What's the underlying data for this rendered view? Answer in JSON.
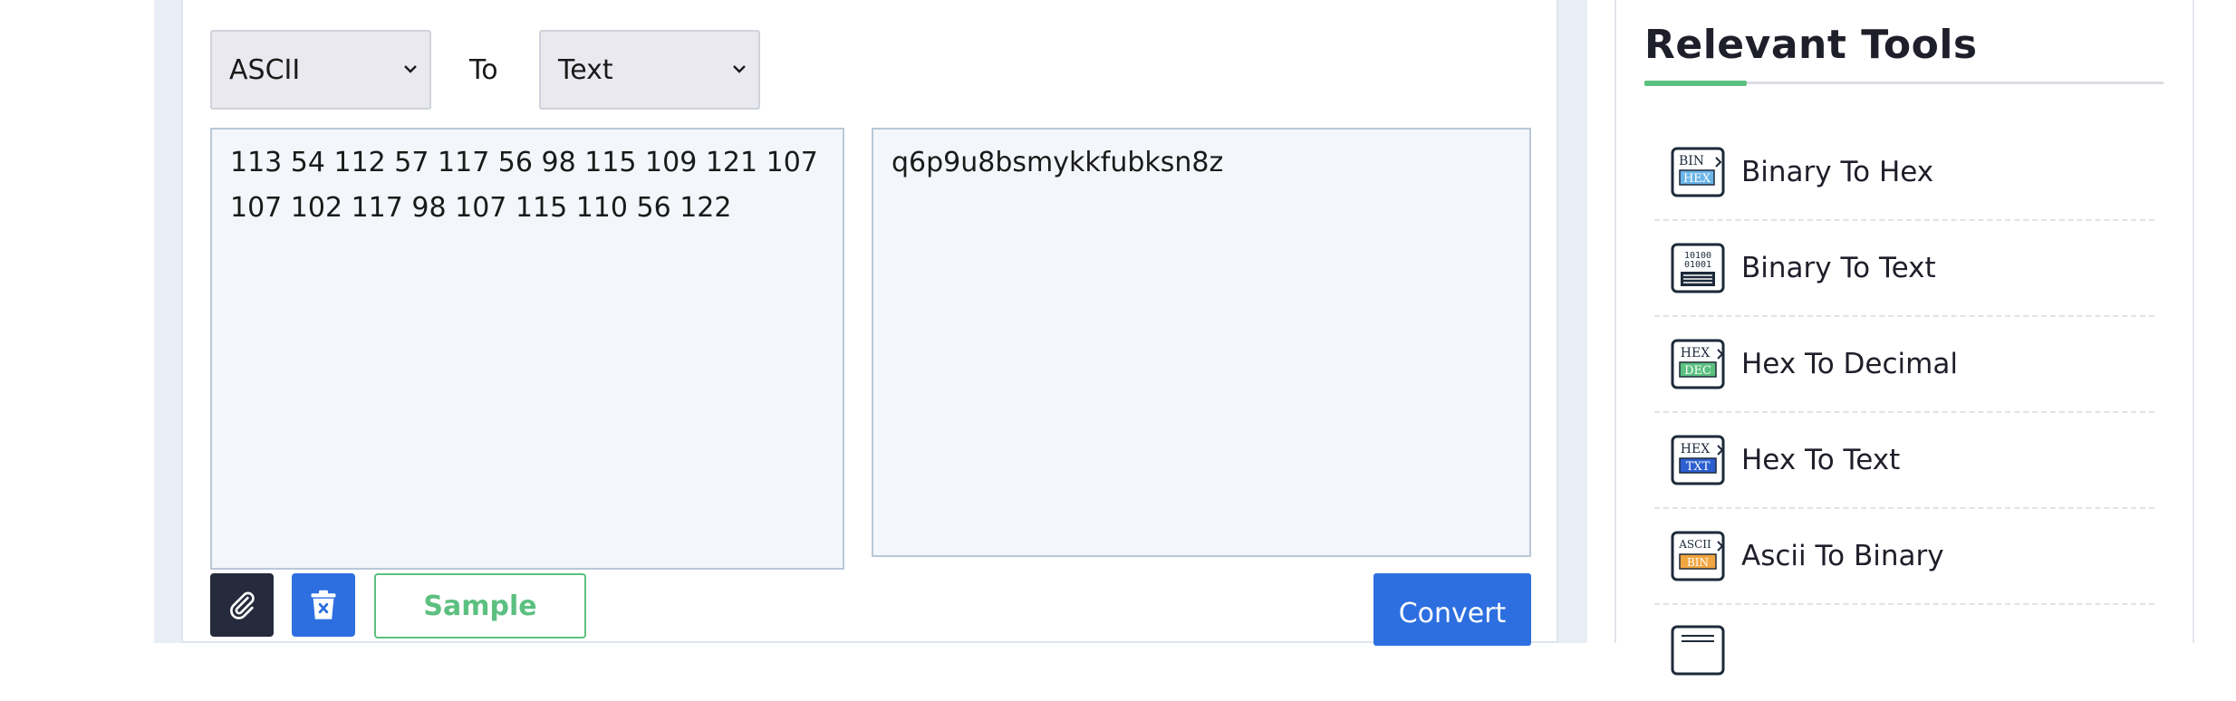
{
  "converter": {
    "from_select": {
      "value": "ASCII"
    },
    "to_label": "To",
    "to_select": {
      "value": "Text"
    },
    "input_text": "113 54 112 57 117 56 98 115 109 121 107 107 102 117 98 107 115 110 56 122",
    "output_text": "q6p9u8bsmykkfubksn8z",
    "sample_label": "Sample",
    "convert_label": "Convert",
    "attach_icon": "paperclip-icon",
    "delete_icon": "trash-icon"
  },
  "sidebar": {
    "title": "Relevant Tools",
    "accent_color": "#5cc080",
    "items": [
      {
        "label": "Binary To Hex",
        "icon": "binary-to-hex-icon"
      },
      {
        "label": "Binary To Text",
        "icon": "binary-to-text-icon"
      },
      {
        "label": "Hex To Decimal",
        "icon": "hex-to-decimal-icon"
      },
      {
        "label": "Hex To Text",
        "icon": "hex-to-text-icon"
      },
      {
        "label": "Ascii To Binary",
        "icon": "ascii-to-binary-icon"
      },
      {
        "label": "",
        "icon": "text-document-icon"
      }
    ]
  },
  "colors": {
    "primary_blue": "#2d6fe0",
    "dark_button": "#252a3c",
    "green": "#5cc080",
    "page_bg": "#e9eef6"
  }
}
